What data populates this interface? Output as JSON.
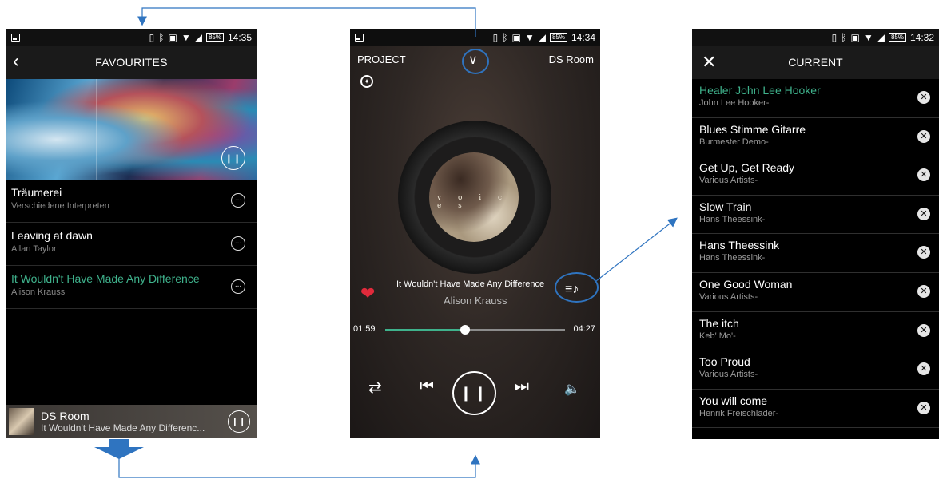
{
  "favourites": {
    "status_time": "14:35",
    "battery": "85%",
    "title": "FAVOURITES",
    "back_icon": "chevron-left-icon",
    "tracks": [
      {
        "title": "Träumerei",
        "artist": "Verschiedene Interpreten",
        "active": false
      },
      {
        "title": "Leaving at dawn",
        "artist": "Allan Taylor",
        "active": false
      },
      {
        "title": "It Wouldn't Have Made Any Difference",
        "artist": "Alison Krauss",
        "active": true
      }
    ],
    "mini_player": {
      "room": "DS Room",
      "track": "It Wouldn't Have Made Any Differenc..."
    }
  },
  "now_playing": {
    "status_time": "14:34",
    "battery": "85%",
    "project_label": "PROJECT",
    "room_label": "DS Room",
    "album_word": "v o i c e s",
    "title": "It Wouldn't Have Made Any Difference",
    "artist": "Alison Krauss",
    "elapsed": "01:59",
    "duration": "04:27",
    "progress_fraction": 0.446,
    "accent_color": "#3fb28c",
    "heart_color": "#e02a3b"
  },
  "current": {
    "status_time": "14:32",
    "battery": "85%",
    "title": "CURRENT",
    "close_icon": "close-icon",
    "queue": [
      {
        "title": "Healer John Lee Hooker",
        "artist": "John Lee Hooker-",
        "active": true
      },
      {
        "title": "Blues Stimme Gitarre",
        "artist": "Burmester Demo-",
        "active": false
      },
      {
        "title": "Get Up, Get Ready",
        "artist": "Various Artists-",
        "active": false
      },
      {
        "title": "Slow Train",
        "artist": "Hans Theessink-",
        "active": false
      },
      {
        "title": "Hans Theessink",
        "artist": "Hans Theessink-",
        "active": false
      },
      {
        "title": "One Good Woman",
        "artist": "Various Artists-",
        "active": false
      },
      {
        "title": "The itch",
        "artist": "Keb' Mo'-",
        "active": false
      },
      {
        "title": "Too Proud",
        "artist": "Various Artists-",
        "active": false
      },
      {
        "title": "You will come",
        "artist": "Henrik Freischlader-",
        "active": false
      }
    ]
  },
  "annotation_color": "#2f74c0"
}
